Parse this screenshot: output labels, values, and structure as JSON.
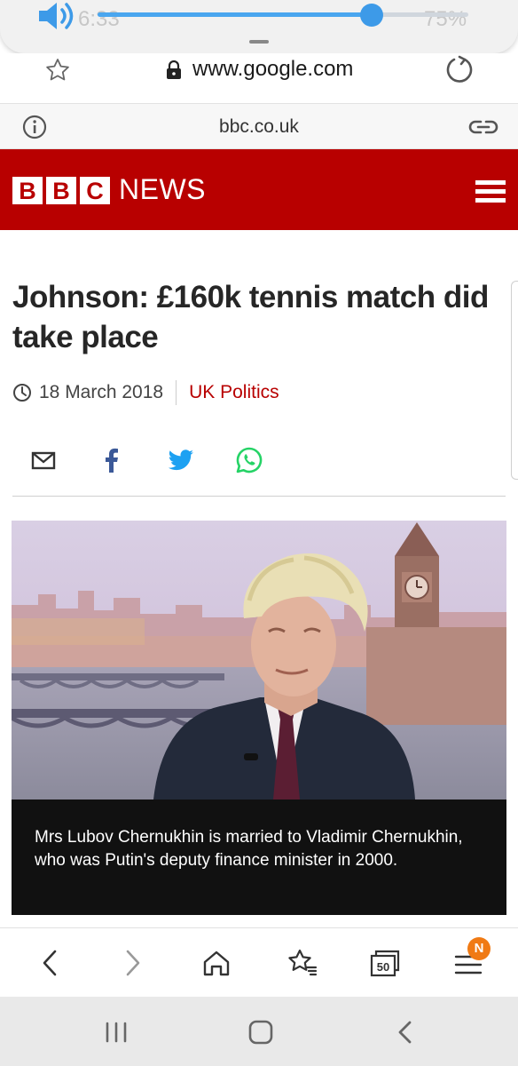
{
  "status_bar": {
    "ghost_time": "6:33",
    "ghost_battery": "75%",
    "volume_level": 0.74
  },
  "browser": {
    "url": "www.google.com",
    "site_domain": "bbc.co.uk",
    "tab_count": "50",
    "menu_badge": "N"
  },
  "site_header": {
    "logo_letters": [
      "B",
      "B",
      "C"
    ],
    "logo_word": "NEWS"
  },
  "article": {
    "headline": "Johnson: £160k tennis match did take place",
    "date": "18 March 2018",
    "category": "UK Politics",
    "caption": "Mrs Lubov Chernukhin is married to Vladimir Chernukhin, who was Putin's deputy finance minister in 2000."
  },
  "colors": {
    "bbc_red": "#b80000",
    "whatsapp_green": "#25d366",
    "twitter_blue": "#1da1f2",
    "facebook_blue": "#3b5998",
    "badge_orange": "#f07a14",
    "volume_blue": "#3d9ae8"
  },
  "icons": {
    "share": [
      "email-icon",
      "facebook-icon",
      "twitter-icon",
      "whatsapp-icon"
    ],
    "toolbar": [
      "back-icon",
      "forward-icon",
      "home-icon",
      "bookmark-icon",
      "tabs-icon",
      "menu-icon"
    ],
    "nav": [
      "recent-apps-icon",
      "home-nav-icon",
      "back-nav-icon"
    ]
  }
}
